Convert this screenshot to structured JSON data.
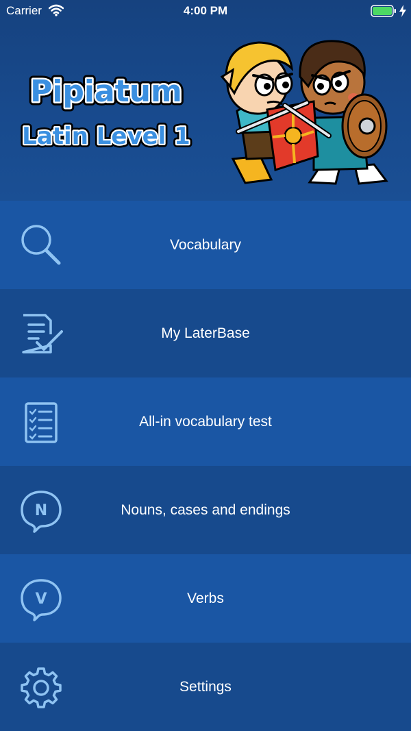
{
  "status_bar": {
    "carrier": "Carrier",
    "time": "4:00 PM"
  },
  "header": {
    "logo_title": "Pipiatum",
    "logo_subtitle": "Latin Level 1"
  },
  "menu": {
    "items": [
      {
        "label": "Vocabulary",
        "icon": "search-icon"
      },
      {
        "label": "My LaterBase",
        "icon": "document-check-icon"
      },
      {
        "label": "All-in vocabulary test",
        "icon": "checklist-icon"
      },
      {
        "label": "Nouns, cases and endings",
        "icon": "noun-bubble-icon",
        "icon_letter": "N"
      },
      {
        "label": "Verbs",
        "icon": "verb-bubble-icon",
        "icon_letter": "V"
      },
      {
        "label": "Settings",
        "icon": "gear-icon"
      }
    ]
  },
  "colors": {
    "header_bg": "#184a8d",
    "row_light": "#1a56a4",
    "row_dark": "#174a8d",
    "icon_stroke": "#8fc3f2",
    "battery": "#4cd964"
  }
}
